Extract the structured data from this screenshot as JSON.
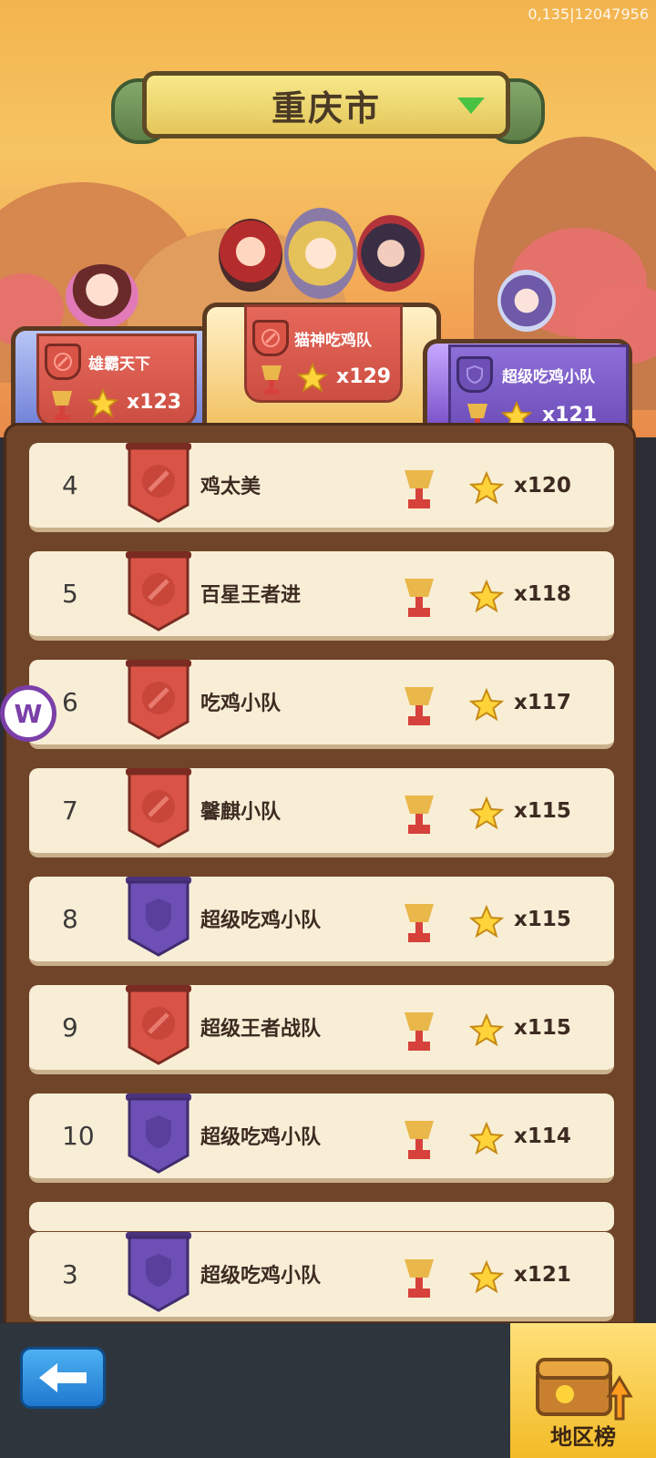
{
  "debug_text": "0,135|12047956",
  "city": {
    "name": "重庆市"
  },
  "podium": [
    {
      "rank": 1,
      "name": "猫神吃鸡队",
      "count": "x129",
      "emblem": "red"
    },
    {
      "rank": 2,
      "name": "雄霸天下",
      "count": "x123",
      "emblem": "red"
    },
    {
      "rank": 3,
      "name": "超级吃鸡小队",
      "count": "x121",
      "emblem": "purple"
    }
  ],
  "rows": [
    {
      "rank": "4",
      "name": "鸡太美",
      "count": "x120",
      "emblem": "red"
    },
    {
      "rank": "5",
      "name": "百星王者进",
      "count": "x118",
      "emblem": "red"
    },
    {
      "rank": "6",
      "name": "吃鸡小队",
      "count": "x117",
      "emblem": "red"
    },
    {
      "rank": "7",
      "name": "馨麒小队",
      "count": "x115",
      "emblem": "red"
    },
    {
      "rank": "8",
      "name": "超级吃鸡小队",
      "count": "x115",
      "emblem": "purple"
    },
    {
      "rank": "9",
      "name": "超级王者战队",
      "count": "x115",
      "emblem": "red"
    },
    {
      "rank": "10",
      "name": "超级吃鸡小队",
      "count": "x114",
      "emblem": "purple"
    }
  ],
  "my_team": {
    "rank": "3",
    "name": "超级吃鸡小队",
    "count": "x121",
    "emblem": "purple"
  },
  "buttons": {
    "back_icon": "arrow-left-icon",
    "region_label": "地区榜"
  },
  "colors": {
    "red_banner": "#d95447",
    "purple_banner": "#6d4fb5",
    "board": "#6f4428",
    "row_bg": "#f8eed6"
  }
}
